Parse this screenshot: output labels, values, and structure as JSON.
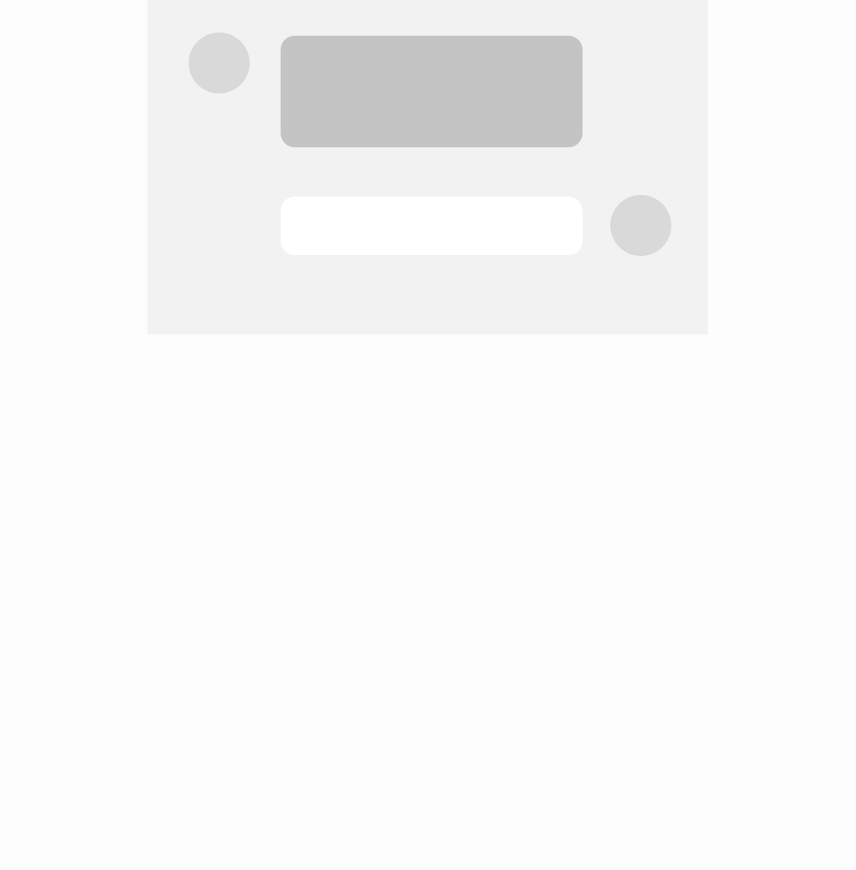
{
  "conversation": {
    "messages": [
      {
        "sender": "other",
        "text": ""
      },
      {
        "sender": "self",
        "text": ""
      }
    ]
  },
  "colors": {
    "page_background": "#fdfdfd",
    "panel_background": "#f2f2f2",
    "avatar_placeholder": "#d9d9d9",
    "received_bubble": "#c4c4c4",
    "sent_bubble": "#ffffff"
  },
  "icons": {
    "left_avatar": "avatar-placeholder-icon",
    "right_avatar": "avatar-placeholder-icon"
  }
}
